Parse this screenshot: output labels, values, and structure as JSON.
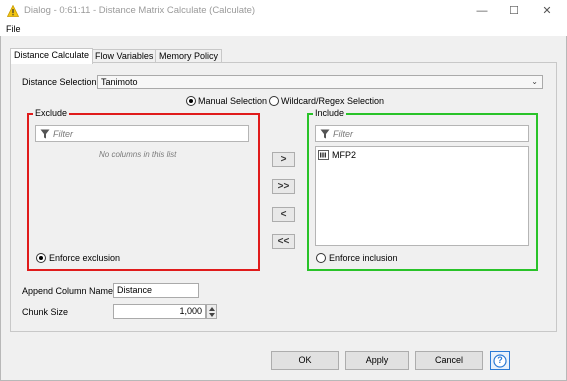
{
  "window": {
    "title": "Dialog - 0:61:11 - Distance Matrix Calculate (Calculate)",
    "minimize_glyph": "—",
    "maximize_glyph": "☐",
    "close_glyph": "✕"
  },
  "menu": {
    "file": "File"
  },
  "tabs": [
    {
      "label": "Distance Calculate",
      "active": true
    },
    {
      "label": "Flow Variables",
      "active": false
    },
    {
      "label": "Memory Policy",
      "active": false
    }
  ],
  "distance_selection": {
    "label": "Distance Selection:",
    "value": "Tanimoto"
  },
  "selection_mode": {
    "manual": "Manual Selection",
    "wildcard": "Wildcard/Regex Selection",
    "selected": "manual"
  },
  "exclude": {
    "title": "Exclude",
    "filter_placeholder": "Filter",
    "empty_message": "No columns in this list",
    "enforce_label": "Enforce exclusion",
    "enforce_selected": true
  },
  "include": {
    "title": "Include",
    "filter_placeholder": "Filter",
    "items": [
      "MFP2"
    ],
    "enforce_label": "Enforce inclusion",
    "enforce_selected": false
  },
  "move_buttons": {
    "add": ">",
    "add_all": ">>",
    "remove": "<",
    "remove_all": "<<"
  },
  "append_column": {
    "label": "Append Column Name",
    "value": "Distance"
  },
  "chunk_size": {
    "label": "Chunk Size",
    "value": "1,000"
  },
  "buttons": {
    "ok": "OK",
    "apply": "Apply",
    "cancel": "Cancel",
    "help": "?"
  },
  "colors": {
    "exclude_border": "#e01b1b",
    "include_border": "#29c329",
    "help_accent": "#2a7ad5"
  },
  "icons": {
    "app": "knime-warning-triangle-icon",
    "filter": "funnel-icon",
    "column": "bitvector-column-icon"
  }
}
